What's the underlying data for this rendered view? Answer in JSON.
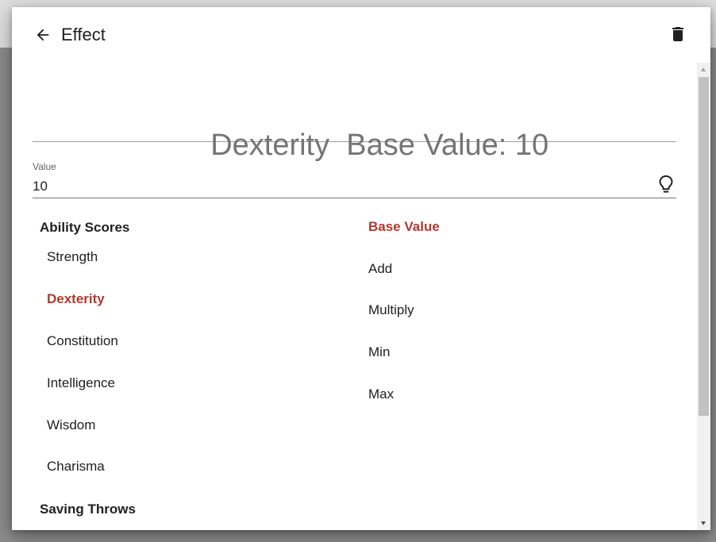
{
  "dialog": {
    "title": "Effect",
    "heading_stat": "Dexterity",
    "heading_base": "Base Value: 10"
  },
  "value_field": {
    "label": "Value",
    "value": "10"
  },
  "stats": {
    "ability_heading": "Ability Scores",
    "items": [
      "Strength",
      "Dexterity",
      "Constitution",
      "Intelligence",
      "Wisdom",
      "Charisma"
    ],
    "selected": "Dexterity",
    "saving_heading": "Saving Throws"
  },
  "modes": {
    "items": [
      "Base Value",
      "Add",
      "Multiply",
      "Min",
      "Max"
    ],
    "selected": "Base Value"
  },
  "icons": {
    "back": "arrow-left-icon",
    "delete": "trash-icon",
    "hint": "lightbulb-icon"
  },
  "colors": {
    "selected": "#b03a2e",
    "text": "#212121",
    "heading": "#757575"
  }
}
